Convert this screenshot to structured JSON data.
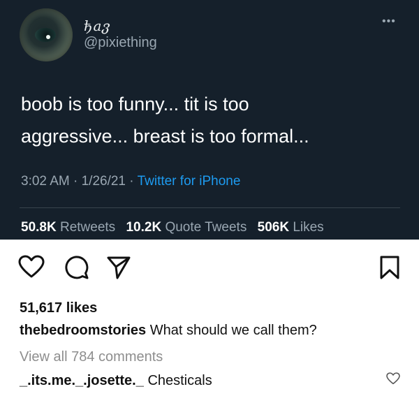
{
  "tweet": {
    "display_name": "ђaვ",
    "handle": "@pixiething",
    "more_icon": "more-horizontal-icon",
    "text_line1": "boob is too funny... tit is too",
    "text_line2": "aggressive... breast is too formal...",
    "time": "3:02 AM",
    "date": "1/26/21",
    "separator": "·",
    "source": "Twitter for iPhone",
    "retweets_count": "50.8K",
    "retweets_label": "Retweets",
    "quotes_count": "10.2K",
    "quotes_label": "Quote Tweets",
    "likes_count": "506K",
    "likes_label": "Likes"
  },
  "post": {
    "icons": {
      "like": "heart-icon",
      "comment": "comment-icon",
      "share": "send-icon",
      "save": "bookmark-icon"
    },
    "likes": "51,617 likes",
    "caption_user": "thebedroomstories",
    "caption_text": "What should we call them?",
    "view_comments": "View all 784 comments",
    "comment_user": "_.its.me._.josette._",
    "comment_text": "Chesticals",
    "comment_like_icon": "heart-outline-small-icon"
  },
  "colors": {
    "tweet_bg": "#15202b",
    "link_blue": "#1d9bf0",
    "muted_gray": "#9aa7b2"
  }
}
